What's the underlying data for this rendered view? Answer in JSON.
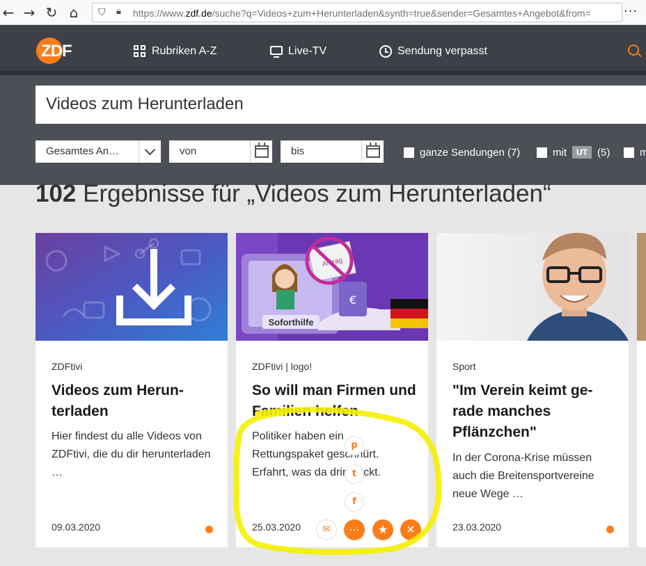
{
  "browser": {
    "back_glyph": "←",
    "forward_glyph": "→",
    "reload_glyph": "↻",
    "home_glyph": "⌂",
    "url_prefix": "https://www.",
    "url_domain": "zdf.de",
    "url_rest": "/suche?q=Videos+zum+Herunterladen&synth=true&sender=Gesamtes+Angebot&from=",
    "menu_glyph": "···"
  },
  "header": {
    "logo_text": "ZDF",
    "nav": [
      {
        "label": "Rubriken A-Z",
        "icon": "grid-icon"
      },
      {
        "label": "Live-TV",
        "icon": "tv-icon"
      },
      {
        "label": "Sendung verpasst",
        "icon": "clock-icon"
      }
    ]
  },
  "search": {
    "query": "Videos zum Herunterladen",
    "sender_select": "Gesamtes An…",
    "from_placeholder": "von",
    "to_placeholder": "bis",
    "filters": [
      {
        "label": "ganze Sendungen (7)"
      },
      {
        "label_pre": "mit",
        "badge": "UT",
        "label_post": "(5)"
      },
      {
        "label": "m"
      }
    ]
  },
  "results": {
    "count": "102",
    "heading_text": "Ergebnisse für „Videos zum Herunterladen“"
  },
  "cards": [
    {
      "channel": "ZDFtivi",
      "title": "Videos zum Herun-terladen",
      "teaser": "Hier findest du alle Videos von ZDFtivi, die du dir herunterladen …",
      "date": "09.03.2020"
    },
    {
      "channel": "ZDFtivi | logo!",
      "title": "So will man Firmen und Familien helfen",
      "teaser_lines": [
        "Politiker haben ein",
        "Rettungspaket geschnürt.",
        "Erfahrt, was da drinsteckt."
      ],
      "image_label": "Soforthilfe",
      "stamp_text": "Antrag",
      "date": "25.03.2020"
    },
    {
      "channel": "Sport",
      "title": "\"Im Verein keimt ge-rade manches Pflänzchen\"",
      "teaser": "In der Corona-Krise müssen auch die Breitensportvereine neue Wege …",
      "date": "23.03.2020"
    }
  ],
  "share": {
    "pinterest": "p",
    "twitter": "t",
    "facebook": "f",
    "mail": "✉",
    "share": "⋯",
    "bookmark": "★",
    "close": "✕"
  },
  "colors": {
    "accent": "#fa7d19",
    "header_bg": "#3d4047",
    "search_bg": "#4c4f56",
    "highlight": "#f5f000"
  }
}
